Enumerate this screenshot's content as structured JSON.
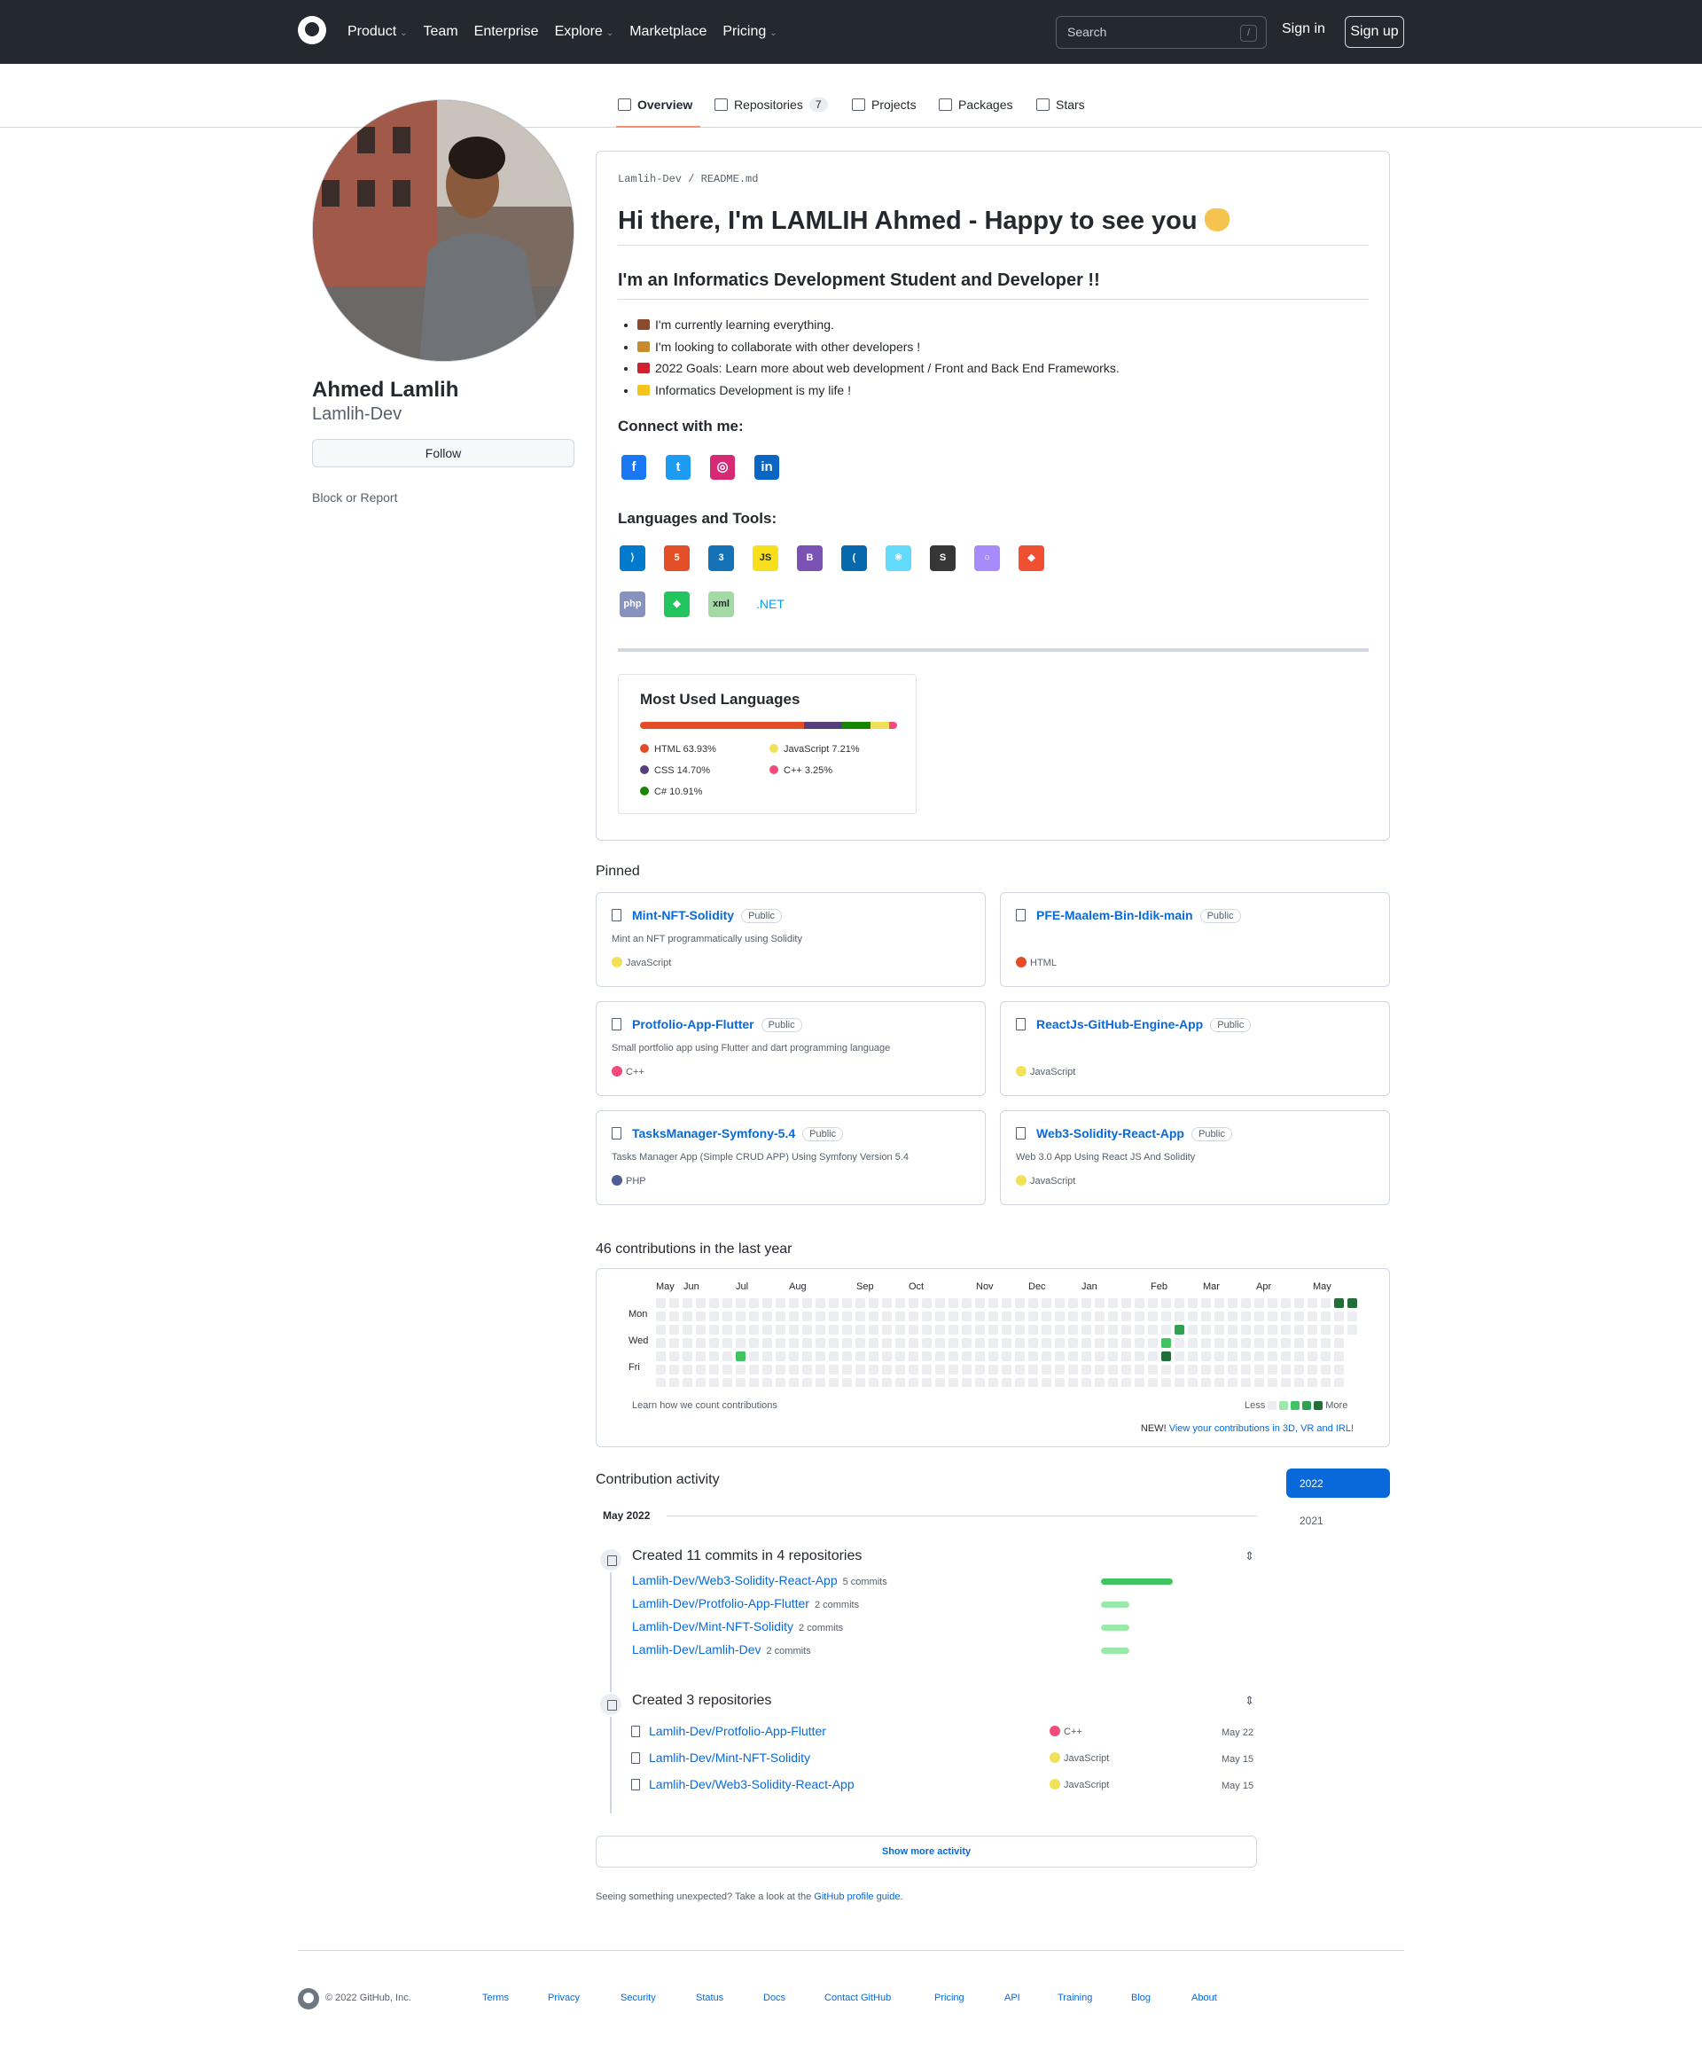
{
  "header": {
    "nav": [
      {
        "label": "Product",
        "dropdown": true
      },
      {
        "label": "Team",
        "dropdown": false
      },
      {
        "label": "Enterprise",
        "dropdown": false
      },
      {
        "label": "Explore",
        "dropdown": true
      },
      {
        "label": "Marketplace",
        "dropdown": false
      },
      {
        "label": "Pricing",
        "dropdown": true
      }
    ],
    "search_placeholder": "Search",
    "search_key": "/",
    "sign_in": "Sign in",
    "sign_up": "Sign up"
  },
  "tabs": [
    {
      "label": "Overview",
      "active": true,
      "count": ""
    },
    {
      "label": "Repositories",
      "active": false,
      "count": "7"
    },
    {
      "label": "Projects",
      "active": false,
      "count": ""
    },
    {
      "label": "Packages",
      "active": false,
      "count": ""
    },
    {
      "label": "Stars",
      "active": false,
      "count": ""
    }
  ],
  "profile": {
    "name": "Ahmed Lamlih",
    "login": "Lamlih-Dev",
    "follow": "Follow",
    "block": "Block or Report"
  },
  "readme": {
    "path_user": "Lamlih-Dev",
    "path_sep": "/",
    "path_file": "README",
    "path_ext": ".md",
    "title": "Hi there, I'm LAMLIH Ahmed - Happy to see you",
    "subtitle": "I'm an Informatics Development Student and Developer !!",
    "bullets": [
      {
        "text": "I'm currently learning everything.",
        "color": "#8b4a2b"
      },
      {
        "text": "I'm looking to collaborate with other developers !",
        "color": "#c98a2d"
      },
      {
        "text": "2022 Goals: Learn more about web development / Front and Back End Frameworks.",
        "color": "#cf222e"
      },
      {
        "text": "Informatics Development is my life !",
        "color": "#f5c518"
      }
    ],
    "connect_title": "Connect with me:",
    "social": [
      {
        "name": "facebook-icon",
        "glyph": "f",
        "color": "#1877f2"
      },
      {
        "name": "twitter-icon",
        "glyph": "t",
        "color": "#1d9bf0"
      },
      {
        "name": "instagram-icon",
        "glyph": "◎",
        "color": "#d62976"
      },
      {
        "name": "linkedin-icon",
        "glyph": "in",
        "color": "#0a66c2"
      }
    ],
    "tools_title": "Languages and Tools:",
    "tools_row1": [
      {
        "name": "vscode-icon",
        "glyph": "⟩",
        "color": "#007acc"
      },
      {
        "name": "html5-icon",
        "glyph": "5",
        "color": "#e34f26"
      },
      {
        "name": "css3-icon",
        "glyph": "3",
        "color": "#1572b6"
      },
      {
        "name": "javascript-icon",
        "glyph": "JS",
        "color": "#f7df1e"
      },
      {
        "name": "bootstrap-icon",
        "glyph": "B",
        "color": "#7952b3"
      },
      {
        "name": "jquery-icon",
        "glyph": "(",
        "color": "#0769ad"
      },
      {
        "name": "react-icon",
        "glyph": "⚛",
        "color": "#61dafb"
      },
      {
        "name": "solidity-icon",
        "glyph": "S",
        "color": "#363636"
      },
      {
        "name": "ipfs-icon",
        "glyph": "○",
        "color": "#a78bfa"
      },
      {
        "name": "git-icon",
        "glyph": "◆",
        "color": "#f05032"
      }
    ],
    "tools_row2": [
      {
        "name": "php-icon",
        "glyph": "php",
        "color": "#8892bf"
      },
      {
        "name": "symfony-icon",
        "glyph": "◆",
        "color": "#22c55e"
      },
      {
        "name": "xml-icon",
        "glyph": "xml",
        "color": "#a3d9a5"
      }
    ],
    "dotnet": ".NET"
  },
  "most_used": {
    "title": "Most Used Languages",
    "languages": [
      {
        "name": "HTML 63.93%",
        "pct": 63.93,
        "color": "#e34c26"
      },
      {
        "name": "CSS 14.70%",
        "pct": 14.7,
        "color": "#563d7c"
      },
      {
        "name": "C# 10.91%",
        "pct": 10.91,
        "color": "#178600"
      },
      {
        "name": "JavaScript 7.21%",
        "pct": 7.21,
        "color": "#f1e05a"
      },
      {
        "name": "C++ 3.25%",
        "pct": 3.25,
        "color": "#f34b7d"
      }
    ]
  },
  "pinned": {
    "title": "Pinned",
    "items": [
      {
        "name": "Mint-NFT-Solidity",
        "badge": "Public",
        "desc": "Mint an NFT programmatically using Solidity",
        "lang": "JavaScript",
        "color": "#f1e05a"
      },
      {
        "name": "PFE-Maalem-Bin-Idik-main",
        "badge": "Public",
        "desc": "",
        "lang": "HTML",
        "color": "#e34c26"
      },
      {
        "name": "Protfolio-App-Flutter",
        "badge": "Public",
        "desc": "Small portfolio app using Flutter and dart programming language",
        "lang": "C++",
        "color": "#f34b7d"
      },
      {
        "name": "ReactJs-GitHub-Engine-App",
        "badge": "Public",
        "desc": "",
        "lang": "JavaScript",
        "color": "#f1e05a"
      },
      {
        "name": "TasksManager-Symfony-5.4",
        "badge": "Public",
        "desc": "Tasks Manager App (Simple CRUD APP) Using Symfony Version 5.4",
        "lang": "PHP",
        "color": "#4F5D95"
      },
      {
        "name": "Web3-Solidity-React-App",
        "badge": "Public",
        "desc": "Web 3.0 App Using React JS And Solidity",
        "lang": "JavaScript",
        "color": "#f1e05a"
      }
    ]
  },
  "contributions": {
    "title": "46 contributions in the last year",
    "months": [
      "May",
      "Jun",
      "Jul",
      "Aug",
      "Sep",
      "Oct",
      "Nov",
      "Dec",
      "Jan",
      "Feb",
      "Mar",
      "Apr",
      "May"
    ],
    "days": [
      "Mon",
      "Wed",
      "Fri"
    ],
    "learn": "Learn how we count contributions",
    "less": "Less",
    "more": "More",
    "new_prefix": "NEW!",
    "new_link": "View your contributions in 3D, VR and IRL!",
    "scale": [
      "#ebedf0",
      "#9be9a8",
      "#40c463",
      "#30a14e",
      "#216e39"
    ],
    "active_cells": [
      [
        6,
        4,
        2
      ],
      [
        38,
        3,
        2
      ],
      [
        38,
        4,
        4
      ],
      [
        39,
        2,
        3
      ],
      [
        51,
        0,
        4
      ],
      [
        52,
        0,
        4
      ]
    ]
  },
  "activity": {
    "title": "Contribution activity",
    "years": [
      "2022",
      "2021"
    ],
    "month": "May 2022",
    "commits_head": "Created 11 commits in 4 repositories",
    "commits": [
      {
        "repo": "Lamlih-Dev/Web3-Solidity-React-App",
        "count": "5 commits",
        "n": 5
      },
      {
        "repo": "Lamlih-Dev/Protfolio-App-Flutter",
        "count": "2 commits",
        "n": 2
      },
      {
        "repo": "Lamlih-Dev/Mint-NFT-Solidity",
        "count": "2 commits",
        "n": 2
      },
      {
        "repo": "Lamlih-Dev/Lamlih-Dev",
        "count": "2 commits",
        "n": 2
      }
    ],
    "repos_head": "Created 3 repositories",
    "repos": [
      {
        "repo": "Lamlih-Dev/Protfolio-App-Flutter",
        "lang": "C++",
        "color": "#f34b7d",
        "date": "May 22"
      },
      {
        "repo": "Lamlih-Dev/Mint-NFT-Solidity",
        "lang": "JavaScript",
        "color": "#f1e05a",
        "date": "May 15"
      },
      {
        "repo": "Lamlih-Dev/Web3-Solidity-React-App",
        "lang": "JavaScript",
        "color": "#f1e05a",
        "date": "May 15"
      }
    ],
    "show_more": "Show more activity",
    "unexpected": "Seeing something unexpected? Take a look at the",
    "guide": "GitHub profile guide."
  },
  "footer": {
    "copyright": "© 2022 GitHub, Inc.",
    "links": [
      "Terms",
      "Privacy",
      "Security",
      "Status",
      "Docs",
      "Contact GitHub",
      "Pricing",
      "API",
      "Training",
      "Blog",
      "About"
    ]
  }
}
